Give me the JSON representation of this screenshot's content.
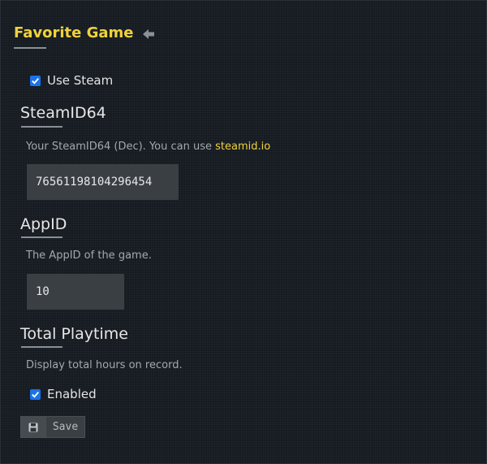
{
  "header": {
    "title": "Favorite Game",
    "back_icon": "arrow-left-icon"
  },
  "use_steam": {
    "label": "Use Steam",
    "checked": true
  },
  "steamid": {
    "heading": "SteamID64",
    "description_prefix": "Your SteamID64 (Dec). You can use ",
    "link_text": "steamid.io",
    "value": "76561198104296454"
  },
  "appid": {
    "heading": "AppID",
    "description": "The AppID of the game.",
    "value": "10"
  },
  "playtime": {
    "heading": "Total Playtime",
    "description": "Display total hours on record.",
    "enabled_label": "Enabled",
    "checked": true
  },
  "save": {
    "label": "Save",
    "icon": "floppy-disk-icon"
  },
  "colors": {
    "accent": "#f0d23a",
    "checkbox": "#1a73e8",
    "background": "#161b21",
    "input_bg": "#3a3f44"
  }
}
